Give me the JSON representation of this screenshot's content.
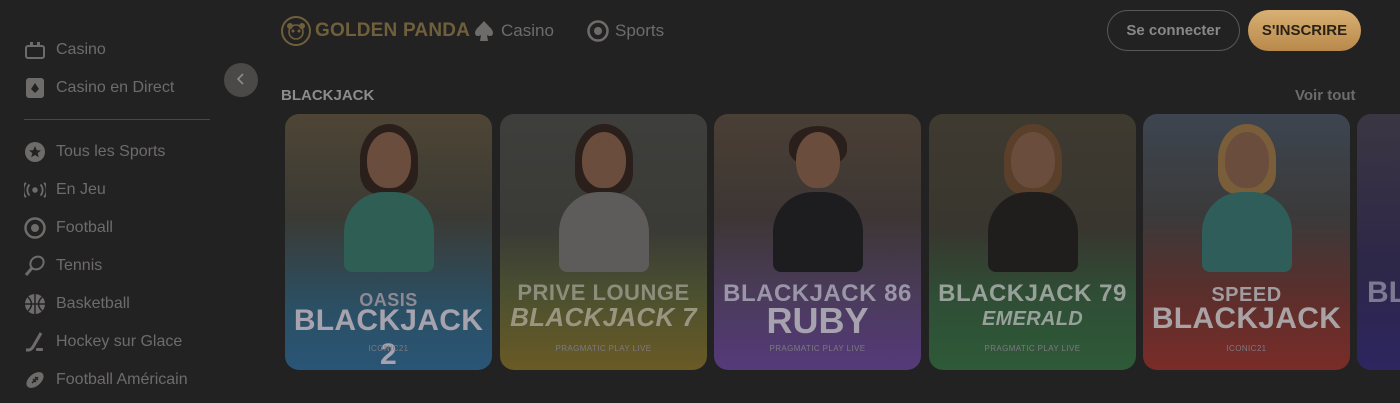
{
  "sidebar": {
    "items": [
      {
        "label": "Casino",
        "icon": "casino-icon"
      },
      {
        "label": "Casino en Direct",
        "icon": "live-casino-icon"
      },
      {
        "label": "Tous les Sports",
        "icon": "star-icon"
      },
      {
        "label": "En Jeu",
        "icon": "broadcast-icon"
      },
      {
        "label": "Football",
        "icon": "soccer-ball-icon"
      },
      {
        "label": "Tennis",
        "icon": "tennis-icon"
      },
      {
        "label": "Basketball",
        "icon": "basketball-icon"
      },
      {
        "label": "Hockey sur Glace",
        "icon": "hockey-icon"
      },
      {
        "label": "Football Américain",
        "icon": "american-football-icon"
      }
    ],
    "collapse_icon": "chevron-left-icon"
  },
  "header": {
    "logo_text": "GOLDEN PANDA",
    "nav": [
      {
        "label": "Casino",
        "icon": "spade-icon"
      },
      {
        "label": "Sports",
        "icon": "soccer-ball-icon"
      }
    ],
    "login_label": "Se connecter",
    "signup_label": "S'INSCRIRE"
  },
  "section": {
    "title": "BLACKJACK",
    "view_all": "Voir tout"
  },
  "cards": [
    {
      "line1": "OASIS",
      "line2": "BLACKJACK 2",
      "line3": "",
      "provider": "ICONIC21"
    },
    {
      "line1": "PRIVE LOUNGE",
      "line2": "BLACKJACK 7",
      "line3": "",
      "provider": "PRAGMATIC PLAY LIVE"
    },
    {
      "line1": "BLACKJACK 86",
      "line2": "",
      "line3": "RUBY",
      "provider": "PRAGMATIC PLAY LIVE"
    },
    {
      "line1": "BLACKJACK 79",
      "line2": "EMERALD",
      "line3": "",
      "provider": "PRAGMATIC PLAY LIVE"
    },
    {
      "line1": "SPEED",
      "line2": "BLACKJACK",
      "line3": "",
      "provider": "ICONIC21"
    }
  ],
  "peek_card": {
    "text": "BL"
  },
  "colors": {
    "background": "#232223",
    "accent_gold": "#c9a060",
    "card_blue": "#2c5f8a",
    "card_yellow": "#8a7a2a",
    "card_purple": "#5d3a8a",
    "card_green": "#2d6a3a",
    "card_red": "#8a2d2a"
  }
}
